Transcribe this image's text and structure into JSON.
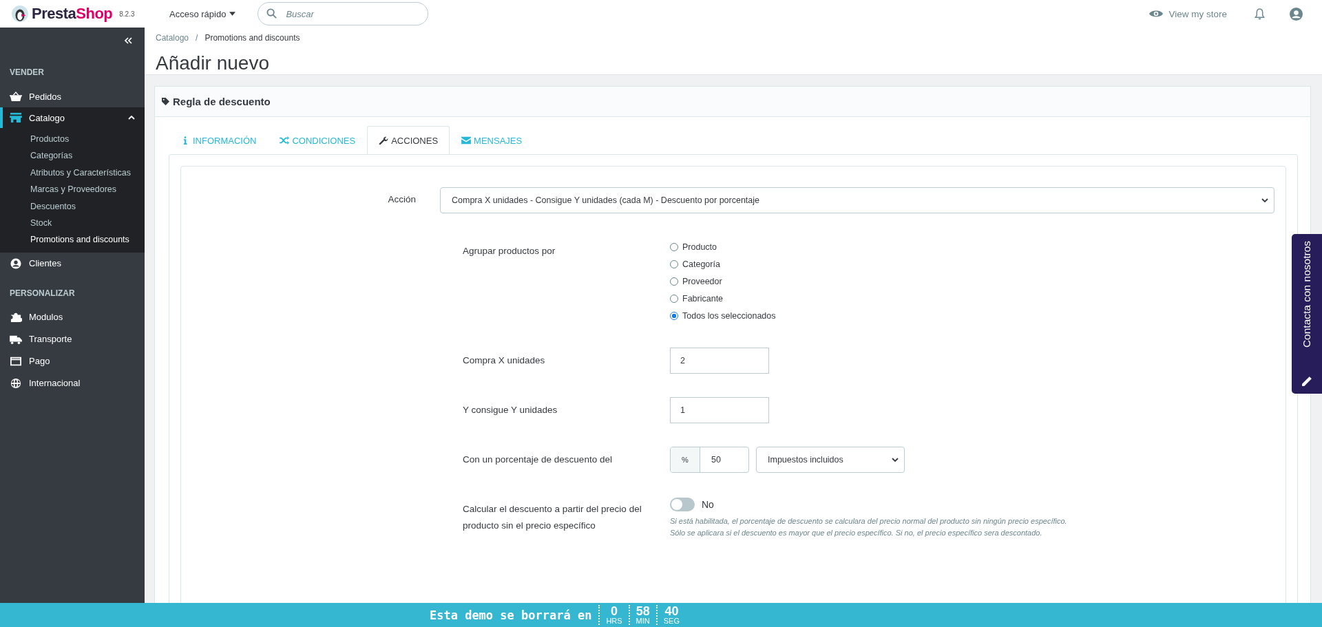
{
  "header": {
    "logo": {
      "parts": [
        "Presta",
        "Shop"
      ]
    },
    "version": "8.2.3",
    "quick_access": "Acceso rápido",
    "search": {
      "placeholder": "Buscar"
    },
    "view_store": "View my store"
  },
  "sidebar": {
    "sections": [
      {
        "title": "VENDER",
        "items": [
          {
            "label": "Pedidos",
            "kind": "basket",
            "selected": false
          },
          {
            "label": "Catalogo",
            "kind": "store",
            "selected": true,
            "expanded": true,
            "children": [
              {
                "label": "Productos",
                "selected": false
              },
              {
                "label": "Categorías",
                "selected": false
              },
              {
                "label": "Atributos y Características",
                "selected": false
              },
              {
                "label": "Marcas y Proveedores",
                "selected": false
              },
              {
                "label": "Descuentos",
                "selected": false
              },
              {
                "label": "Stock",
                "selected": false
              },
              {
                "label": "Promotions and discounts",
                "selected": true
              }
            ]
          },
          {
            "label": "Clientes",
            "kind": "user",
            "selected": false
          }
        ]
      },
      {
        "title": "PERSONALIZAR",
        "items": [
          {
            "label": "Modulos",
            "kind": "puzzle",
            "selected": false
          },
          {
            "label": "Transporte",
            "kind": "truck",
            "selected": false
          },
          {
            "label": "Pago",
            "kind": "card",
            "selected": false
          },
          {
            "label": "Internacional",
            "kind": "globe",
            "selected": false
          }
        ]
      }
    ]
  },
  "breadcrumb": {
    "separator": "/",
    "items": [
      "Catalogo",
      "Promotions and discounts"
    ]
  },
  "page_title": "Añadir nuevo",
  "panel": {
    "title": "Regla de descuento",
    "tabs": [
      {
        "label": "INFORMACIÓN",
        "kind": "info",
        "selected": false
      },
      {
        "label": "CONDICIONES",
        "kind": "shuffle",
        "selected": false
      },
      {
        "label": "ACCIONES",
        "kind": "wrench",
        "selected": true
      },
      {
        "label": "MENSAJES",
        "kind": "envelope",
        "selected": false
      }
    ]
  },
  "form": {
    "rows": [
      {
        "kind": "select",
        "label": "Acción",
        "value": "Compra X unidades - Consigue Y unidades (cada M) - Descuento por porcentaje"
      },
      {
        "kind": "radio",
        "label": "Agrupar productos por",
        "options": [
          {
            "label": "Producto",
            "selected": false
          },
          {
            "label": "Categoría",
            "selected": false
          },
          {
            "label": "Proveedor",
            "selected": false
          },
          {
            "label": "Fabricante",
            "selected": false
          },
          {
            "label": "Todos los seleccionados",
            "selected": true
          }
        ]
      },
      {
        "kind": "text",
        "label": "Compra X unidades",
        "value": "2"
      },
      {
        "kind": "text",
        "label": "Y consigue Y unidades",
        "value": "1"
      },
      {
        "kind": "percent",
        "label": "Con un porcentaje de descuento del",
        "prefix": "%",
        "value": "50",
        "select": "Impuestos incluidos"
      },
      {
        "kind": "switch",
        "label": "Calcular el descuento a partir del precio del producto sin el precio específico",
        "on": false,
        "state_label": "No",
        "help": [
          "Si está habilitada, el porcentaje de descuento se calculara del precio normal del producto sin ningún precio específico.",
          "Sólo se aplicara si el descuento es mayor que el precio específico. Si no, el precio específico sera descontado."
        ]
      }
    ]
  },
  "contact_tab": "Contacta con nosotros",
  "demo_bar": {
    "text": "Esta demo se borrará en",
    "units": [
      {
        "value": "0",
        "label": "HRS"
      },
      {
        "value": "58",
        "label": "MIN"
      },
      {
        "value": "40",
        "label": "SEG"
      }
    ]
  }
}
